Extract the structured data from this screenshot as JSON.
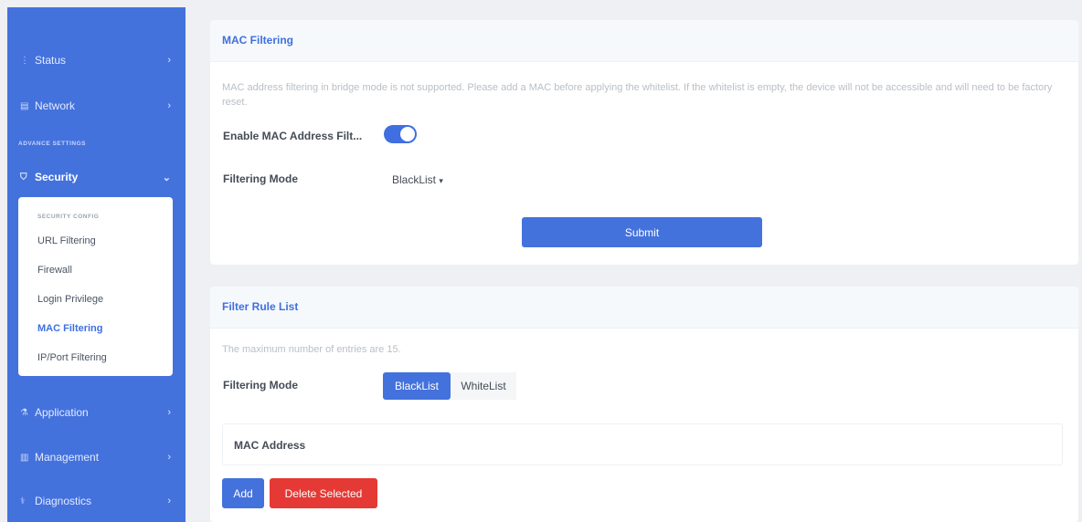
{
  "sidebar": {
    "items": [
      {
        "label": "Status",
        "icon": "info-icon"
      },
      {
        "label": "Network",
        "icon": "network-icon"
      }
    ],
    "section_label": "ADVANCE SETTINGS",
    "security": {
      "label": "Security",
      "icon": "shield-icon"
    },
    "submenu": {
      "title": "SECURITY CONFIG",
      "items": [
        "URL Filtering",
        "Firewall",
        "Login Privilege",
        "MAC Filtering",
        "IP/Port Filtering"
      ],
      "active": "MAC Filtering"
    },
    "bottom_items": [
      {
        "label": "Application",
        "icon": "application-icon"
      },
      {
        "label": "Management",
        "icon": "management-icon"
      },
      {
        "label": "Diagnostics",
        "icon": "diagnostics-icon"
      }
    ]
  },
  "mac_filtering": {
    "title": "MAC Filtering",
    "note": "MAC address filtering in bridge mode is not supported. Please add a MAC before applying the whitelist. If the whitelist is empty, the device will not be accessible and will need to be factory reset.",
    "enable_label": "Enable MAC Address Filt...",
    "enabled": true,
    "mode_label": "Filtering Mode",
    "mode_value": "BlackList",
    "submit_label": "Submit"
  },
  "filter_rules": {
    "title": "Filter Rule List",
    "note": "The maximum number of entries are 15.",
    "mode_label": "Filtering Mode",
    "modes": [
      "BlackList",
      "WhiteList"
    ],
    "active_mode": "BlackList",
    "column_header": "MAC Address",
    "add_label": "Add",
    "delete_label": "Delete Selected"
  },
  "colors": {
    "primary": "#4472dc",
    "danger": "#e53935",
    "title_blue": "#3f6fe0"
  }
}
